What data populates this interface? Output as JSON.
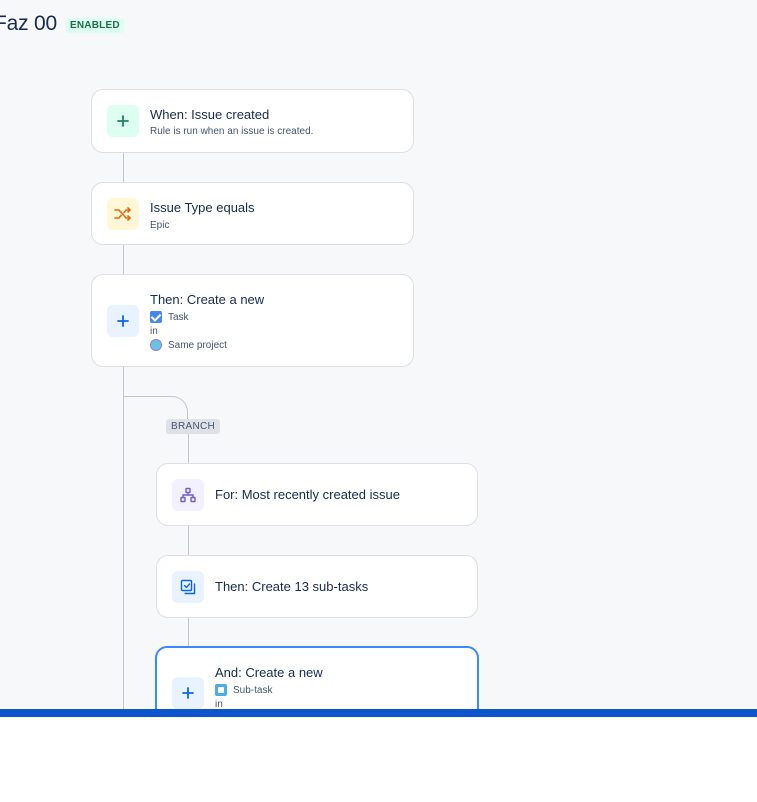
{
  "header": {
    "title": "Faz 00",
    "status_badge": "ENABLED"
  },
  "flow": {
    "trigger": {
      "title": "When: Issue created",
      "subtitle": "Rule is run when an issue is created."
    },
    "condition": {
      "title": "Issue Type equals",
      "subtitle": "Epic"
    },
    "action": {
      "title": "Then: Create a new",
      "issue_type": "Task",
      "in_label": "in",
      "project": "Same project"
    },
    "branch_label": "BRANCH",
    "branch": {
      "for": {
        "title": "For: Most recently created issue"
      },
      "subtasks": {
        "title": "Then: Create 13 sub-tasks"
      },
      "and_create": {
        "title": "And: Create a new",
        "issue_type": "Sub-task",
        "in_label": "in"
      }
    }
  },
  "colors": {
    "canvas_bg": "#f7f8f9",
    "accent_blue": "#0c66e4",
    "enabled_green": "#216e4e",
    "selected_border": "#388bff",
    "bottom_bar": "#0c55cd"
  },
  "icons": {
    "trigger": "plus-icon",
    "condition": "shuffle-icon",
    "action": "plus-icon",
    "for": "hierarchy-icon",
    "subtasks": "checklist-icon",
    "and_create": "plus-icon"
  }
}
